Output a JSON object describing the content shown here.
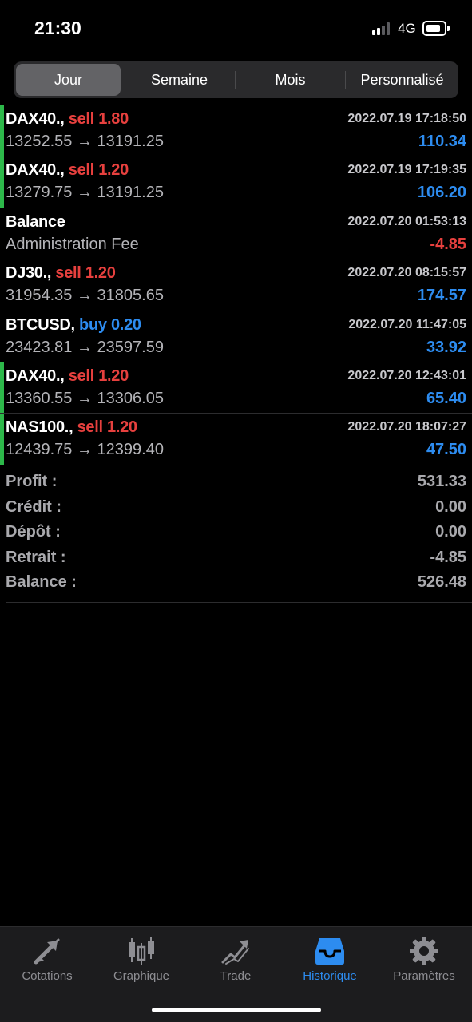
{
  "status_bar": {
    "time": "21:30",
    "network": "4G",
    "signal_bars_active": 2,
    "signal_bars_total": 4,
    "battery_level": 0.7
  },
  "period_tabs": [
    {
      "label": "Jour",
      "active": true
    },
    {
      "label": "Semaine",
      "active": false
    },
    {
      "label": "Mois",
      "active": false
    },
    {
      "label": "Personnalisé",
      "active": false
    }
  ],
  "deals": [
    {
      "symbol": "DAX40.",
      "type": "sell",
      "volume": "1.80",
      "time": "2022.07.19 17:18:50",
      "prices": "13252.55 → 13191.25",
      "profit": "110.34",
      "profit_sign": "positive",
      "marker": true
    },
    {
      "symbol": "DAX40.",
      "type": "sell",
      "volume": "1.20",
      "time": "2022.07.19 17:19:35",
      "prices": "13279.75 → 13191.25",
      "profit": "106.20",
      "profit_sign": "positive",
      "marker": true
    },
    {
      "symbol": "Balance",
      "type": "",
      "volume": "",
      "time": "2022.07.20 01:53:13",
      "prices": "Administration Fee",
      "profit": "-4.85",
      "profit_sign": "negative",
      "marker": false
    },
    {
      "symbol": "DJ30.",
      "type": "sell",
      "volume": "1.20",
      "time": "2022.07.20 08:15:57",
      "prices": "31954.35 → 31805.65",
      "profit": "174.57",
      "profit_sign": "positive",
      "marker": false
    },
    {
      "symbol": "BTCUSD",
      "type": "buy",
      "volume": "0.20",
      "time": "2022.07.20 11:47:05",
      "prices": "23423.81 → 23597.59",
      "profit": "33.92",
      "profit_sign": "positive",
      "marker": false
    },
    {
      "symbol": "DAX40.",
      "type": "sell",
      "volume": "1.20",
      "time": "2022.07.20 12:43:01",
      "prices": "13360.55 → 13306.05",
      "profit": "65.40",
      "profit_sign": "positive",
      "marker": true
    },
    {
      "symbol": "NAS100.",
      "type": "sell",
      "volume": "1.20",
      "time": "2022.07.20 18:07:27",
      "prices": "12439.75 → 12399.40",
      "profit": "47.50",
      "profit_sign": "positive",
      "marker": true
    }
  ],
  "summary": [
    {
      "label": "Profit :",
      "value": "531.33"
    },
    {
      "label": "Crédit :",
      "value": "0.00"
    },
    {
      "label": "Dépôt :",
      "value": "0.00"
    },
    {
      "label": "Retrait :",
      "value": "-4.85"
    },
    {
      "label": "Balance :",
      "value": "526.48"
    }
  ],
  "tab_bar": [
    {
      "label": "Cotations",
      "icon": "quotes-arrows-icon",
      "active": false
    },
    {
      "label": "Graphique",
      "icon": "candlestick-chart-icon",
      "active": false
    },
    {
      "label": "Trade",
      "icon": "trade-trend-icon",
      "active": false
    },
    {
      "label": "Historique",
      "icon": "history-tray-icon",
      "active": true
    },
    {
      "label": "Paramètres",
      "icon": "gear-icon",
      "active": false
    }
  ],
  "colors": {
    "sell": "#e7403e",
    "buy": "#2d8cf0",
    "profit_positive": "#2d8cf0",
    "profit_negative": "#e7403e",
    "row_marker": "#2db84a",
    "active_tab": "#2d8cf0"
  }
}
